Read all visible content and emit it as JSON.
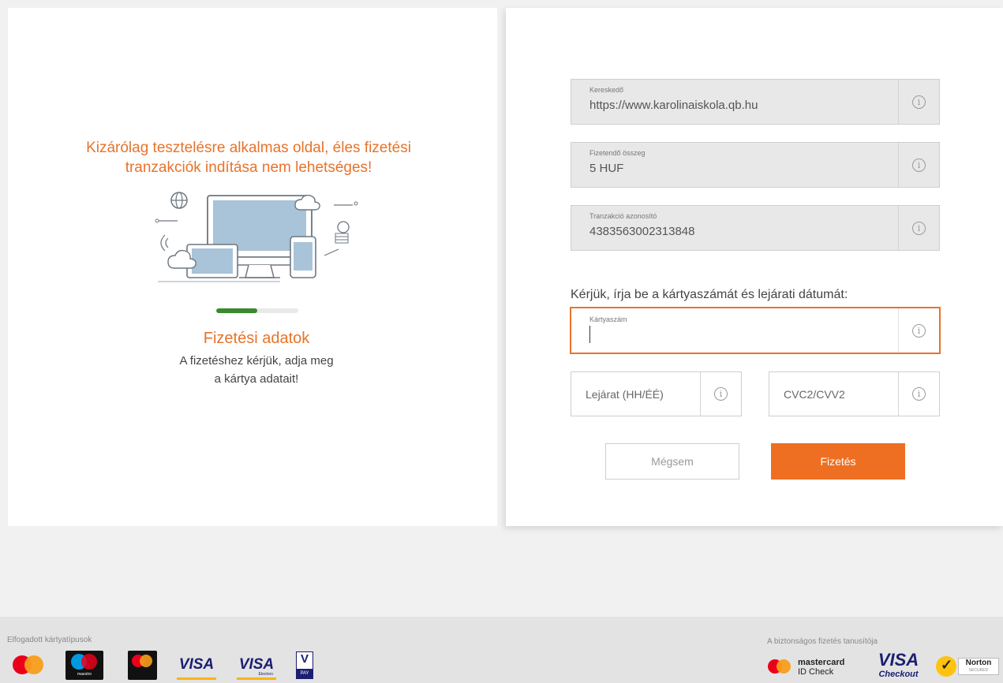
{
  "left": {
    "warning_line1": "Kizárólag tesztelésre alkalmas oldal, éles fizetési",
    "warning_line2": "tranzakciók indítása nem lehetséges!",
    "progress_fraction": 0.5,
    "step_title": "Fizetési adatok",
    "step_desc_line1": "A fizetéshez kérjük, adja meg",
    "step_desc_line2": "a kártya adatait!"
  },
  "form": {
    "merchant": {
      "label": "Kereskedő",
      "value": "https://www.karolinaiskola.qb.hu"
    },
    "amount": {
      "label": "Fizetendő összeg",
      "value": "5 HUF"
    },
    "transaction": {
      "label": "Tranzakció azonosító",
      "value": "4383563002313848"
    },
    "instruction": "Kérjük, írja be a kártyaszámát és lejárati dátumát:",
    "card_number": {
      "label": "Kártyaszám",
      "value": ""
    },
    "expiry": {
      "placeholder": "Lejárat (HH/ÉÉ)"
    },
    "cvc": {
      "placeholder": "CVC2/CVV2"
    },
    "cancel_label": "Mégsem",
    "pay_label": "Fizetés",
    "info_glyph": "i"
  },
  "footer": {
    "accepted_label": "Elfogadott kártyatípusok",
    "security_label": "A biztonságos fizetés tanusítója",
    "maestro_text": "maestro",
    "visa_text": "VISA",
    "visa_electron_text": "Electron",
    "vpay_v": "V",
    "vpay_pay": "PAY",
    "mc_id_line1": "mastercard",
    "mc_id_line2": "ID Check",
    "visa_checkout_line1": "VISA",
    "visa_checkout_line2": "Checkout",
    "norton_text": "Norton",
    "norton_sub": "SECURED"
  },
  "colors": {
    "accent": "#ee6f22",
    "progress": "#3a8a2e",
    "mc_red": "#eb001b",
    "mc_orange": "#f79e1b",
    "maestro_blue": "#0099df",
    "visa_blue": "#1a1f71",
    "norton_yellow": "#ffc20e"
  }
}
